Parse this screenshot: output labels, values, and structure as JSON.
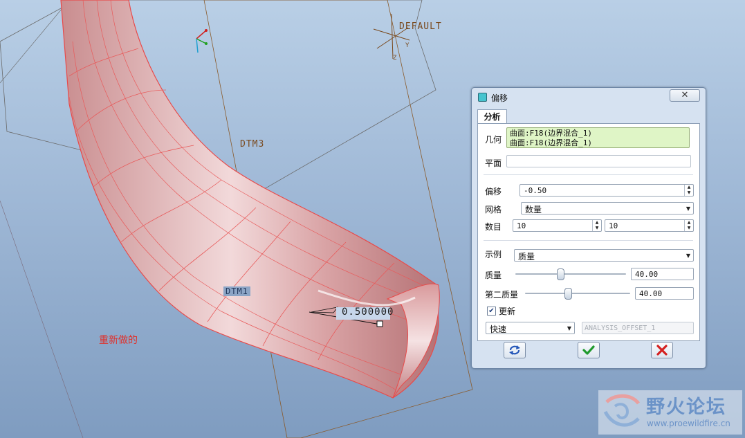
{
  "viewport": {
    "labels": {
      "default_csys": "DEFAULT",
      "dtm3": "DTM3",
      "dtm1": "DTM1",
      "csys_axis_y": "Y",
      "csys_axis_z": "Z"
    },
    "dimension_value": "0.500000",
    "note_text": "重新做的"
  },
  "dialog": {
    "title": "偏移",
    "close_symbol": "✕",
    "tabs": [
      {
        "label": "分析",
        "active": true
      }
    ],
    "geometry": {
      "label": "几何",
      "items": [
        "曲面:F18(边界混合_1)",
        "曲面:F18(边界混合_1)"
      ]
    },
    "plane": {
      "label": "平面",
      "value": ""
    },
    "offset": {
      "label": "偏移",
      "value": "-0.50"
    },
    "grid": {
      "label": "网格",
      "value": "数量"
    },
    "count": {
      "label": "数目",
      "value1": "10",
      "value2": "10"
    },
    "display": {
      "label": "示例",
      "value": "质量"
    },
    "quality": {
      "label": "质量",
      "value": "40.00",
      "slider_fraction": 0.4
    },
    "second_quality": {
      "label": "第二质量",
      "value": "40.00",
      "slider_fraction": 0.4
    },
    "update": {
      "label": "更新",
      "checked": true
    },
    "mode": {
      "value": "快速"
    },
    "analysis_name": {
      "value": "ANALYSIS_OFFSET_1"
    },
    "buttons": {
      "repeat": "repeat-icon",
      "ok": "check-icon",
      "cancel": "cross-icon"
    },
    "colors": {
      "ok": "#1f9a2e",
      "cancel": "#d42020",
      "repeat": "#2456b8",
      "geometry_bg": "#dff5c6"
    }
  },
  "watermark": {
    "main": "野火论坛",
    "sub": "www.proewildfire.cn"
  }
}
